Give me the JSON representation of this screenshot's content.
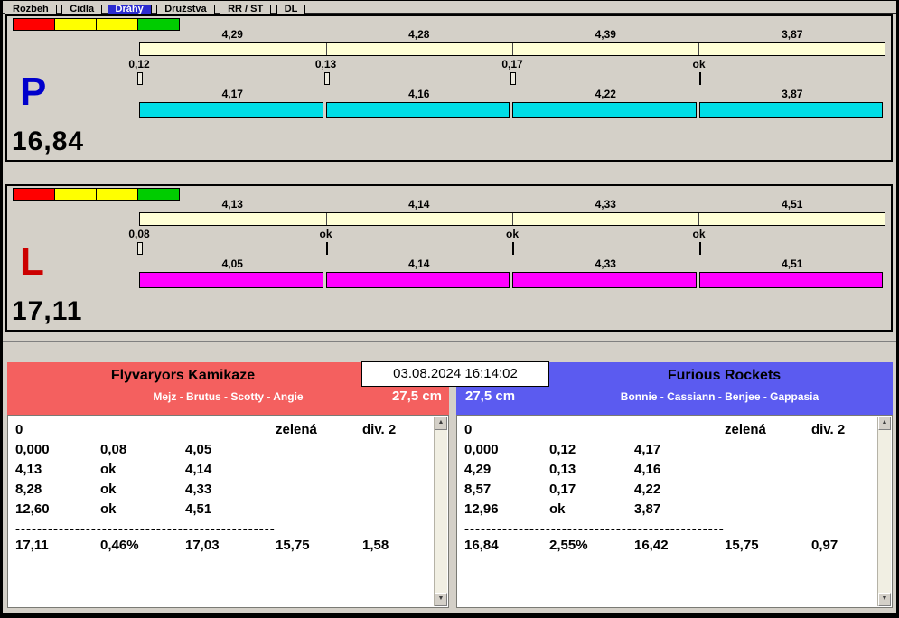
{
  "tabs": [
    {
      "label": "Rozbeh"
    },
    {
      "label": "Cidla"
    },
    {
      "label": "Dráhy",
      "active": true
    },
    {
      "label": "Družstva"
    },
    {
      "label": "RR / ST"
    },
    {
      "label": "DL"
    }
  ],
  "colors": {
    "window_bg": "#d4d0c8",
    "light_red": "#ff0000",
    "light_yellow": "#ffff00",
    "light_green": "#00cc00",
    "split_bar": "#ffffd6",
    "active_tab": "#2b2bd0",
    "team_left_header": "#f4605f",
    "team_right_header": "#5b5bf0"
  },
  "lanes": [
    {
      "letter": "P",
      "letter_color": "#0000cc",
      "total": "16,84",
      "bar_color": "#00dde6",
      "splits_top": [
        "4,29",
        "4,28",
        "4,39",
        "3,87"
      ],
      "marks": [
        "0,12",
        "0,13",
        "0,17",
        "ok"
      ],
      "splits_bottom": [
        "4,17",
        "4,16",
        "4,22",
        "3,87"
      ]
    },
    {
      "letter": "L",
      "letter_color": "#cc0000",
      "total": "17,11",
      "bar_color": "#ff00ff",
      "splits_top": [
        "4,13",
        "4,14",
        "4,33",
        "4,51"
      ],
      "marks": [
        "0,08",
        "ok",
        "ok",
        "ok"
      ],
      "splits_bottom": [
        "4,05",
        "4,14",
        "4,33",
        "4,51"
      ]
    }
  ],
  "timestamp": "03.08.2024 16:14:02",
  "teams": [
    {
      "name": "Flyvaryors Kamikaze",
      "members": "Mejz - Brutus - Scotty - Angie",
      "height": "27,5 cm",
      "first_row": {
        "c0": "0",
        "c3": "zelená",
        "c4": "div. 2"
      },
      "rows": [
        [
          "0,000",
          "0,08",
          "4,05"
        ],
        [
          "4,13",
          "ok",
          "4,14"
        ],
        [
          "8,28",
          "ok",
          "4,33"
        ],
        [
          "12,60",
          "ok",
          "4,51"
        ]
      ],
      "dashes": "------------------------------------------------------------",
      "totals": [
        "17,11",
        "0,46%",
        "17,03",
        "15,75",
        "1,58"
      ]
    },
    {
      "name": "Furious Rockets",
      "members": "Bonnie - Cassiann - Benjee - Gappasia",
      "height": "27,5 cm",
      "first_row": {
        "c0": "0",
        "c3": "zelená",
        "c4": "div. 2"
      },
      "rows": [
        [
          "0,000",
          "0,12",
          "4,17"
        ],
        [
          "4,29",
          "0,13",
          "4,16"
        ],
        [
          "8,57",
          "0,17",
          "4,22"
        ],
        [
          "12,96",
          "ok",
          "3,87"
        ]
      ],
      "dashes": "------------------------------------------------------------",
      "totals": [
        "16,84",
        "2,55%",
        "16,42",
        "15,75",
        "0,97"
      ]
    }
  ],
  "icons": {
    "scroll_up": "▲",
    "scroll_down": "▼"
  }
}
